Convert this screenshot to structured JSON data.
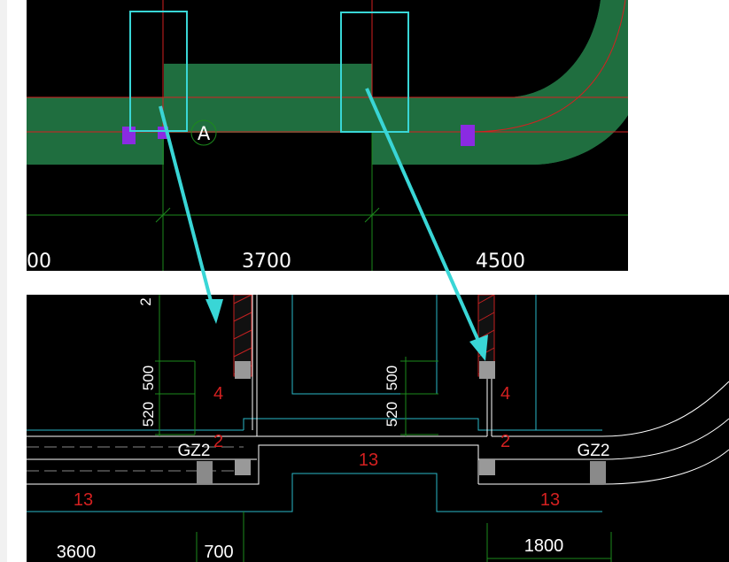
{
  "top": {
    "dims": [
      "00",
      "3700",
      "4500"
    ],
    "axis_label": "A"
  },
  "bottom": {
    "top_fragment": "2",
    "left_dims": [
      "520",
      "500"
    ],
    "right_dims": [
      "520",
      "500"
    ],
    "labels_red": [
      "4",
      "2",
      "13",
      "13",
      "4",
      "2",
      "13"
    ],
    "gz_left": "GZ2",
    "gz_right": "GZ2",
    "bottom_dims": [
      "3600",
      "700",
      "1800"
    ]
  },
  "colors": {
    "wall_green": "#1f6e3f",
    "highlight_cyan": "#39d6d6",
    "axis_red": "#d42020",
    "column_purple": "#8a2be2",
    "grid_green": "#1c8a1c"
  }
}
